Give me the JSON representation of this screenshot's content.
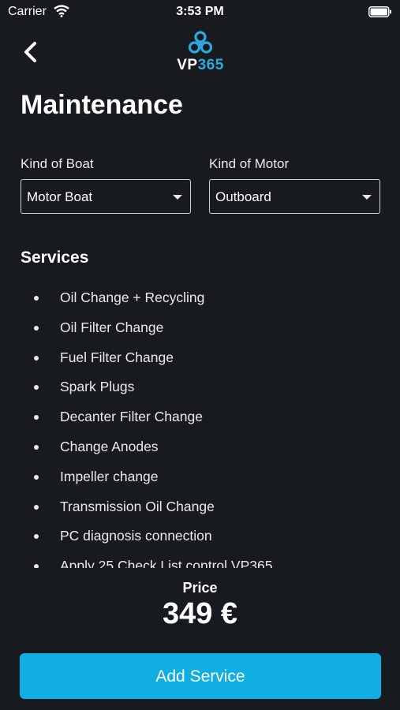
{
  "status_bar": {
    "carrier": "Carrier",
    "time": "3:53 PM"
  },
  "header": {
    "logo_vp": "VP",
    "logo_num": "365"
  },
  "page": {
    "title": "Maintenance"
  },
  "filters": {
    "boat_label": "Kind of Boat",
    "boat_value": "Motor Boat",
    "motor_label": "Kind of Motor",
    "motor_value": "Outboard"
  },
  "services": {
    "title": "Services",
    "items": [
      "Oil Change + Recycling",
      "Oil Filter Change",
      "Fuel Filter Change",
      "Spark Plugs",
      "Decanter Filter Change",
      "Change Anodes",
      "Impeller change",
      "Transmission Oil Change",
      "PC diagnosis connection",
      "Apply 25 Check List control VP365"
    ]
  },
  "price": {
    "label": "Price",
    "value": "349 €"
  },
  "actions": {
    "add_service": "Add Service"
  },
  "colors": {
    "background": "#171b20",
    "accent": "#10aee2",
    "logo_blue": "#2ea8dc"
  }
}
